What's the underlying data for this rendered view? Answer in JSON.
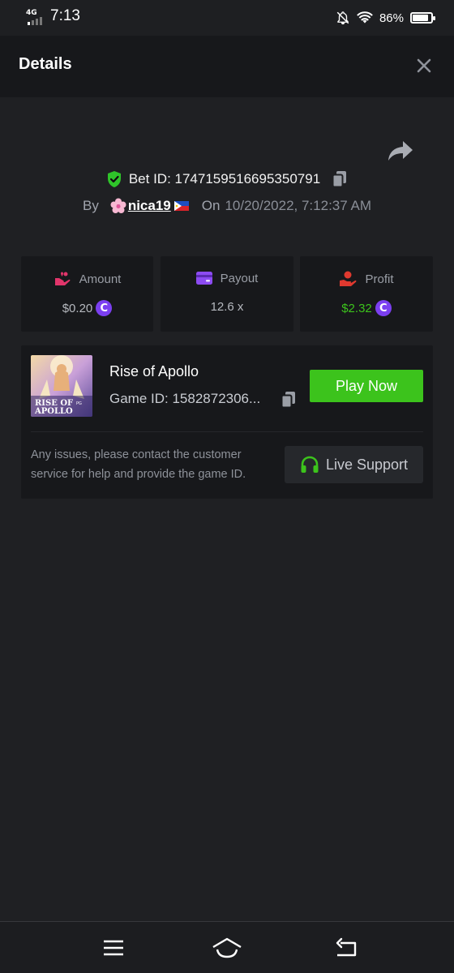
{
  "status_bar": {
    "network": "4G",
    "time": "7:13",
    "battery_percent": "86%",
    "battery_level": 0.86
  },
  "header": {
    "title": "Details",
    "close_icon": "close-icon"
  },
  "bet": {
    "id_text": "Bet ID: 1747159516695350791",
    "by_label": "By",
    "username": "nica19",
    "username_prefix_icon": "cherry-blossom-icon",
    "username_suffix_icon": "philippines-flag-icon",
    "on_label": "On",
    "date": "10/20/2022, 7:12:37 AM"
  },
  "stats": [
    {
      "label": "Amount",
      "value": "$0.20",
      "icon": "amount-icon",
      "has_coin": true,
      "value_color": "#b6b9bf"
    },
    {
      "label": "Payout",
      "value": "12.6 x",
      "icon": "payout-icon",
      "has_coin": false,
      "value_color": "#b6b9bf"
    },
    {
      "label": "Profit",
      "value": "$2.32",
      "icon": "profit-icon",
      "has_coin": true,
      "value_color": "#3cc31c"
    }
  ],
  "coin_symbol": "C",
  "game": {
    "name": "Rise of Apollo",
    "id_text": "Game ID: 1582872306...",
    "thumb_title_line1": "RISE OF",
    "thumb_title_line2": "APOLLO",
    "thumb_badge": "PG",
    "play_label": "Play Now",
    "support_text": "Any issues, please contact the customer service for help and provide the game ID.",
    "support_label": "Live Support"
  },
  "colors": {
    "accent_green": "#3cc31c",
    "coin_purple": "#7b3ff0",
    "background": "#1f2023",
    "card": "#17181b"
  }
}
